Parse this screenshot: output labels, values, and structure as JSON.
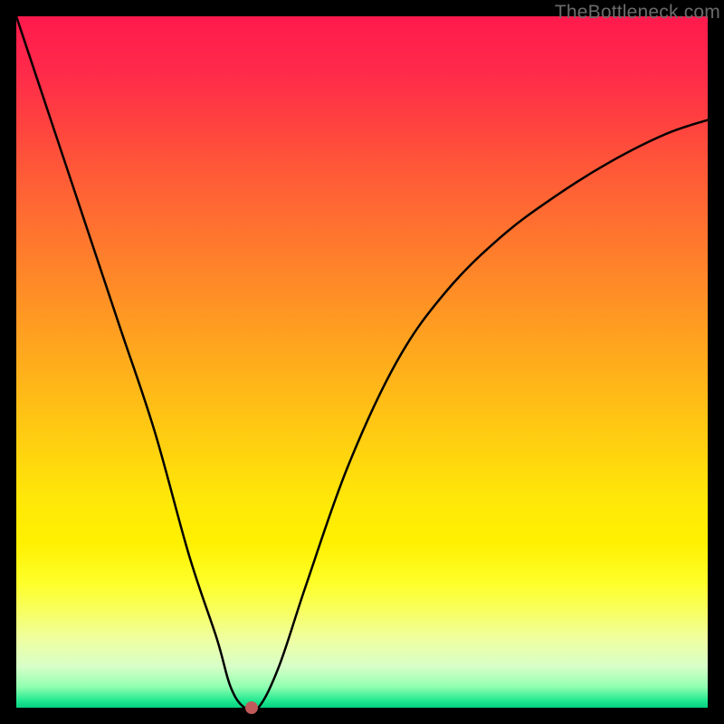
{
  "attribution": "TheBottleneck.com",
  "chart_data": {
    "type": "line",
    "title": "",
    "xlabel": "",
    "ylabel": "",
    "xlim": [
      0,
      100
    ],
    "ylim": [
      0,
      100
    ],
    "gradient_meaning": "vertical gradient from red (top / high bottleneck) through yellow to green (bottom / low bottleneck)",
    "series": [
      {
        "name": "bottleneck-curve",
        "x": [
          0,
          5,
          10,
          15,
          20,
          25,
          29,
          31,
          33,
          35,
          38,
          42,
          48,
          55,
          62,
          70,
          78,
          86,
          94,
          100
        ],
        "y": [
          100,
          85,
          70,
          55,
          40,
          22,
          10,
          3,
          0,
          0,
          6,
          18,
          35,
          50,
          60,
          68,
          74,
          79,
          83,
          85
        ]
      }
    ],
    "marker": {
      "x": 34.0,
      "y": 0
    },
    "colors": {
      "curve": "#000000",
      "marker": "#c05a5a",
      "gradient_top": "#ff1a4d",
      "gradient_mid": "#fff000",
      "gradient_bottom": "#06d080"
    }
  }
}
